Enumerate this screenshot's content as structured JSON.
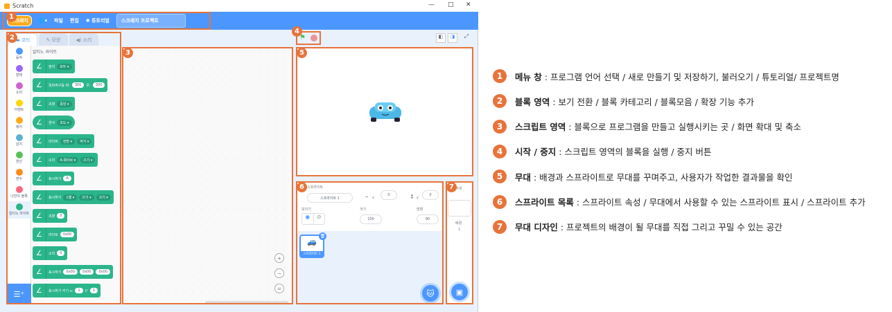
{
  "window": {
    "title": "Scratch"
  },
  "menu": {
    "logo": "스크래치",
    "file": "파일",
    "edit": "편집",
    "tutorial": "튜토리얼",
    "project_name": "스크래치 프로젝트"
  },
  "tabs": {
    "code": "코드",
    "costume": "모양",
    "sound": "소리"
  },
  "categories": [
    {
      "label": "동작",
      "color": "#4c97ff"
    },
    {
      "label": "형태",
      "color": "#9966ff"
    },
    {
      "label": "소리",
      "color": "#cf63cf"
    },
    {
      "label": "이벤트",
      "color": "#ffd500"
    },
    {
      "label": "제어",
      "color": "#ffab19"
    },
    {
      "label": "감지",
      "color": "#5cb1d6"
    },
    {
      "label": "연산",
      "color": "#59c059"
    },
    {
      "label": "변수",
      "color": "#ff8c1a"
    },
    {
      "label": "나만의 블록",
      "color": "#ff6680"
    },
    {
      "label": "알티노 라이트",
      "color": "#2bb58a"
    }
  ],
  "palette_title": "알티노 라이트",
  "blocks": [
    {
      "label": "정지",
      "args": [
        {
          "t": "dd",
          "v": "모두"
        }
      ]
    },
    {
      "label": "뒷바퀴구동 좌:",
      "args": [
        {
          "t": "pill",
          "v": "300"
        },
        {
          "t": "txt",
          "v": "우:"
        },
        {
          "t": "pill",
          "v": "300"
        }
      ]
    },
    {
      "label": "조향",
      "args": [
        {
          "t": "dd",
          "v": "중앙"
        }
      ]
    },
    {
      "label": "센서",
      "args": [
        {
          "t": "dd",
          "v": "조도"
        }
      ]
    },
    {
      "label": "라이트",
      "args": [
        {
          "t": "dd",
          "v": "전방"
        },
        {
          "t": "dd",
          "v": "켜기"
        }
      ]
    },
    {
      "label": "소리",
      "args": [
        {
          "t": "dd",
          "v": "4-옥타브"
        },
        {
          "t": "dd",
          "v": "끄기"
        }
      ]
    },
    {
      "label": "표시하기",
      "args": [
        {
          "t": "pill",
          "v": "A"
        }
      ]
    },
    {
      "label": "표시하기",
      "args": [
        {
          "t": "dd",
          "v": "1행"
        },
        {
          "t": "dd",
          "v": "끄기"
        },
        {
          "t": "dd",
          "v": "끄기"
        }
      ]
    },
    {
      "label": "조향",
      "args": [
        {
          "t": "pill",
          "v": "0"
        }
      ]
    },
    {
      "label": "라이트",
      "args": [
        {
          "t": "pill",
          "v": "0x00"
        }
      ]
    },
    {
      "label": "소리",
      "args": [
        {
          "t": "pill",
          "v": "0"
        }
      ]
    },
    {
      "label": "표시하기",
      "args": [
        {
          "t": "pill",
          "v": "0x00"
        },
        {
          "t": "pill",
          "v": "0x00"
        },
        {
          "t": "pill",
          "v": "0x00"
        }
      ]
    },
    {
      "label": "표시하기 커기 x:",
      "args": [
        {
          "t": "pill",
          "v": "1"
        },
        {
          "t": "txt",
          "v": "y:"
        },
        {
          "t": "pill",
          "v": "1"
        }
      ]
    }
  ],
  "sprite": {
    "header": "스프라이트",
    "name": "스프라이트 1",
    "x_label": "x",
    "x": "0",
    "y_label": "y",
    "y": "0",
    "show_label": "보이기",
    "size_label": "크기",
    "size": "100",
    "direction_label": "방향",
    "direction": "90",
    "thumb_label": "스프라이트 1"
  },
  "stage_pane": {
    "header": "무대",
    "backdrop_label": "배경",
    "backdrop_count": "1"
  },
  "callouts": [
    "1",
    "2",
    "3",
    "4",
    "5",
    "6",
    "7"
  ],
  "descriptions": [
    {
      "num": "1",
      "title": "메뉴 창",
      "text": " : 프로그램 언어 선택 / 새로 만들기 및 저장하기, 불러오기 / 튜토리얼/ 프로젝트명"
    },
    {
      "num": "2",
      "title": "블록 영역",
      "text": " : 보기 전환 / 블록 카테고리 / 블록모음 / 확장 기능 추가"
    },
    {
      "num": "3",
      "title": "스크립트 영역",
      "text": " : 블록으로 프로그램을 만들고 실행시키는 곳 / 화면 확대 및 축소"
    },
    {
      "num": "4",
      "title": "시작 / 중지",
      "text": " : 스크립트 영역의 블록을 실행 / 중지 버튼"
    },
    {
      "num": "5",
      "title": "무대",
      "text": " : 배경과 스프라이트로 무대를 꾸며주고, 사용자가 작업한 결과물을 확인"
    },
    {
      "num": "6",
      "title": "스프라이트 목록",
      "text": " : 스프라이트 속성 / 무대에서 사용할 수 있는 스프라이트 표시 / 스프라이트 추가"
    },
    {
      "num": "7",
      "title": "무대 디자인",
      "text": " : 프로젝트의 배경이 될 무대를 직접 그리고 꾸밀 수 있는 공간"
    }
  ]
}
